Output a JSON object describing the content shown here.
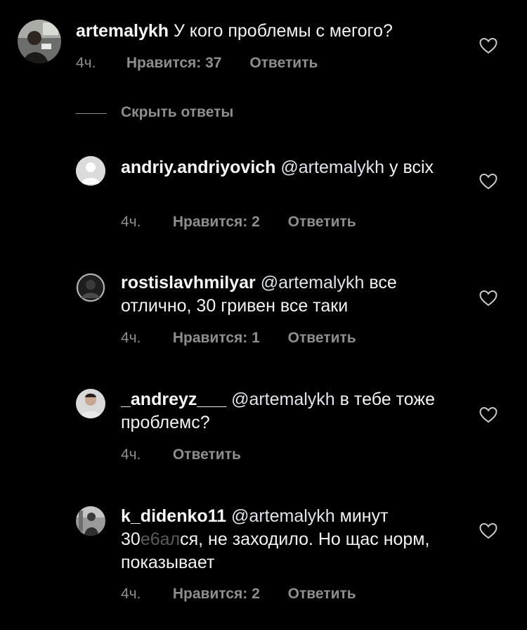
{
  "comments": [
    {
      "username": "artemalykh",
      "mention": "",
      "text": "У кого проблемы с мегого?",
      "time": "4ч.",
      "likes": "Нравится: 37",
      "reply": "Ответить"
    },
    {
      "username": "andriy.andriyovich",
      "mention": "@artemalykh",
      "text": "у всіх",
      "time": "4ч.",
      "likes": "Нравится: 2",
      "reply": "Ответить"
    },
    {
      "username": "rostislavhmilyar",
      "mention": "@artemalykh",
      "text": "все отлично, 30 гривен все таки",
      "time": "4ч.",
      "likes": "Нравится: 1",
      "reply": "Ответить"
    },
    {
      "username": "_andreyz___",
      "mention": "@artemalykh",
      "text": "в тебе тоже проблемс?",
      "time": "4ч.",
      "likes": "",
      "reply": "Ответить"
    },
    {
      "username": "k_didenko11",
      "mention": "@artemalykh",
      "text_before": "минут 30",
      "text_blurred": "е6ал",
      "text_after": "ся, не заходило. Но щас норм, показывает",
      "time": "4ч.",
      "likes": "Нравится: 2",
      "reply": "Ответить"
    }
  ],
  "hide_replies_label": "Скрыть ответы",
  "icons": {
    "like": "heart-outline-icon"
  },
  "colors": {
    "background": "#000000",
    "text": "#f2f2f2",
    "meta": "#8e8e8e"
  }
}
